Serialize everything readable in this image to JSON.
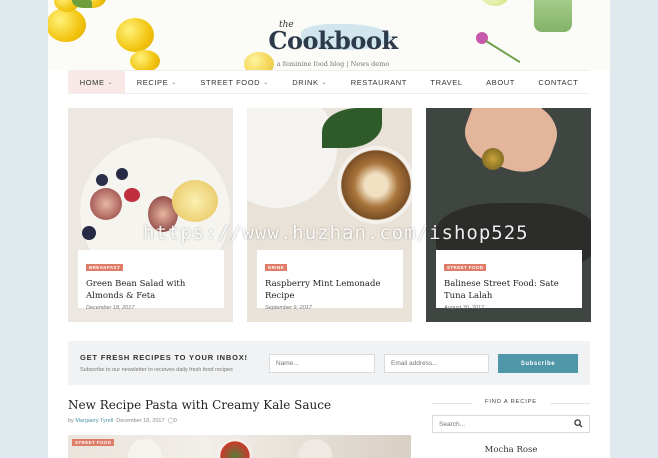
{
  "header": {
    "logo_small": "the",
    "logo_main": "Cookbook",
    "tagline": "a feminine food blog | News demo"
  },
  "nav": {
    "items": [
      {
        "label": "Home",
        "has_dropdown": true,
        "active": true
      },
      {
        "label": "Recipe",
        "has_dropdown": true
      },
      {
        "label": "Street Food",
        "has_dropdown": true
      },
      {
        "label": "Drink",
        "has_dropdown": true
      },
      {
        "label": "Restaurant",
        "has_dropdown": false
      },
      {
        "label": "Travel",
        "has_dropdown": false
      },
      {
        "label": "About",
        "has_dropdown": false
      },
      {
        "label": "Contact",
        "has_dropdown": false
      }
    ],
    "dropdown_icon": "chevron-down-icon"
  },
  "featured": [
    {
      "tag": "Breakfast",
      "title": "Green Bean Salad with Almonds & Feta",
      "date": "December 18, 2017"
    },
    {
      "tag": "Drink",
      "title": "Raspberry Mint Lemonade Recipe",
      "date": "September 9, 2017"
    },
    {
      "tag": "Street Food",
      "title": "Balinese Street Food: Sate Tuna Lalah",
      "date": "August 30, 2017"
    }
  ],
  "watermark": "https://www.huzhan.com/ishop525",
  "newsletter": {
    "title": "Get fresh recipes to your inbox!",
    "subtitle": "Subscribe to our newsletter to receives daily fresh food recipes",
    "name_placeholder": "Name...",
    "email_placeholder": "Email address...",
    "button": "Subscribe"
  },
  "post": {
    "title": "New Recipe Pasta with Creamy Kale Sauce",
    "by": "by",
    "author": "Margaery Tyrell",
    "date": "December 18, 2017",
    "comments": "0",
    "tag": "Street Food"
  },
  "sidebar": {
    "heading": "Find a recipe",
    "search_placeholder": "Search...",
    "search_icon": "search-icon",
    "next_title": "Mocha Rose"
  },
  "colors": {
    "accent": "#e07d69",
    "button": "#4f97a8",
    "nav_active_bg": "#f9e9e6",
    "page_bg": "#dfe9ee"
  }
}
